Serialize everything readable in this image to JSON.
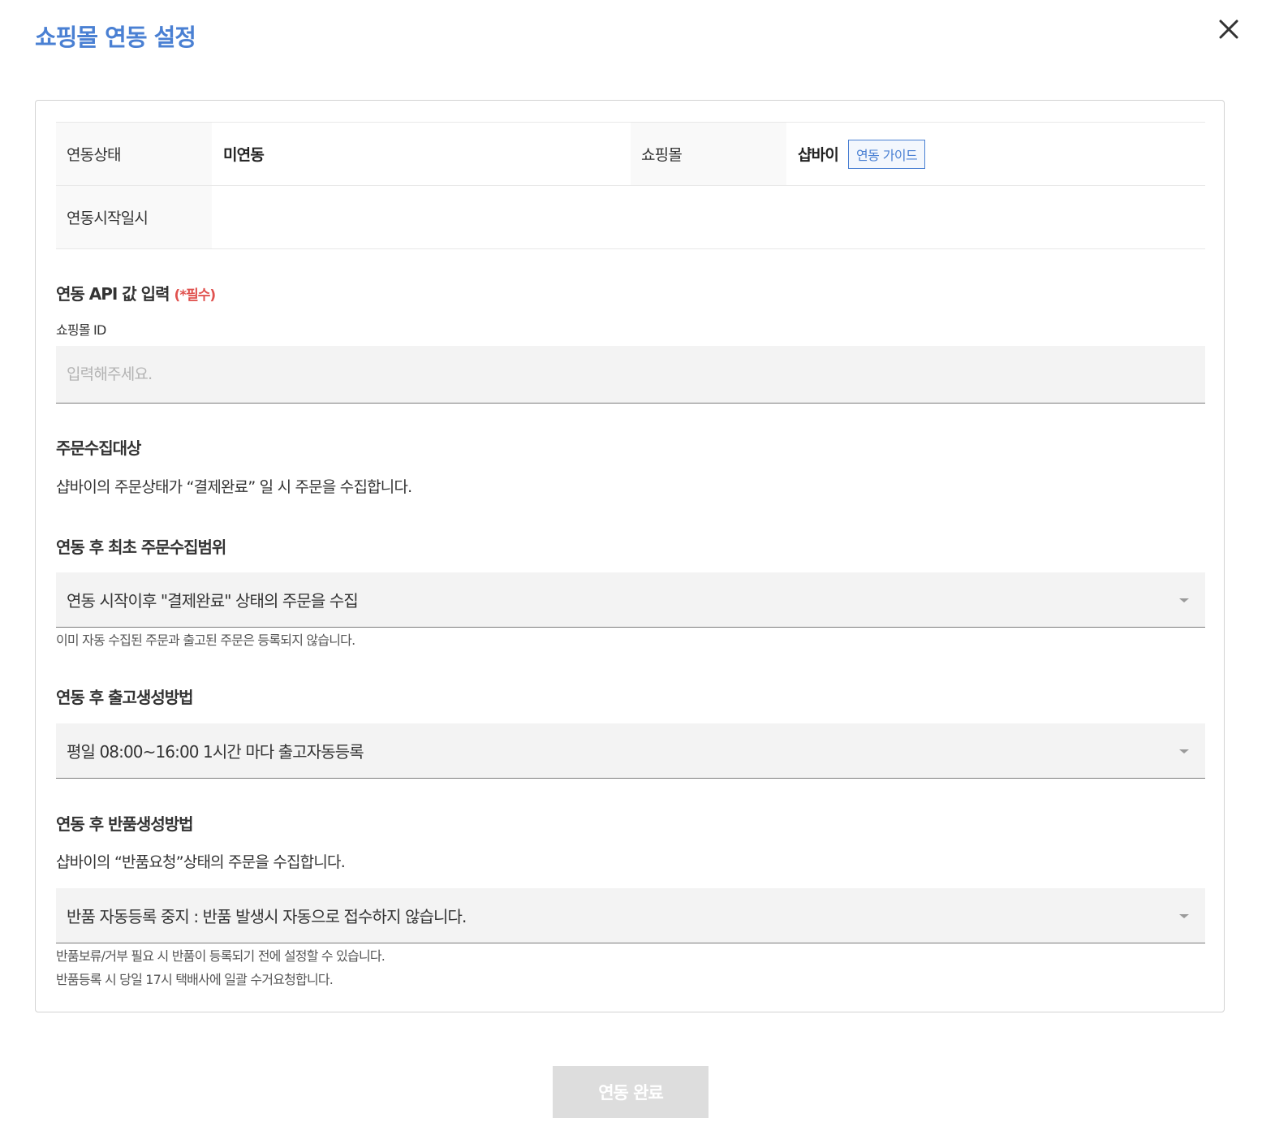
{
  "modal": {
    "title": "쇼핑몰 연동 설정"
  },
  "info": {
    "status_label": "연동상태",
    "status_value": "미연동",
    "mall_label": "쇼핑몰",
    "mall_value": "샵바이",
    "guide_button": "연동 가이드",
    "start_label": "연동시작일시",
    "start_value": ""
  },
  "api": {
    "heading": "연동 API 값 입력",
    "required": "(*필수)",
    "mall_id_label": "쇼핑몰 ID",
    "mall_id_placeholder": "입력해주세요.",
    "mall_id_value": ""
  },
  "order_target": {
    "heading": "주문수집대상",
    "description": "샵바이의 주문상태가 “결제완료” 일 시 주문을 수집합니다."
  },
  "initial_range": {
    "heading": "연동 후 최초 주문수집범위",
    "selected": "연동 시작이후 \"결제완료\" 상태의 주문을 수집",
    "note": "이미 자동 수집된 주문과 출고된 주문은 등록되지 않습니다."
  },
  "shipment": {
    "heading": "연동 후 출고생성방법",
    "selected": "평일 08:00~16:00 1시간 마다 출고자동등록"
  },
  "returns": {
    "heading": "연동 후 반품생성방법",
    "description": "샵바이의 “반품요청”상태의 주문을 수집합니다.",
    "selected": "반품 자동등록 중지 : 반품 발생시 자동으로 접수하지 않습니다.",
    "note_1": "반품보류/거부 필요 시 반품이 등록되기 전에 설정할 수 있습니다.",
    "note_2": "반품등록 시 당일 17시 택배사에 일괄 수거요청합니다."
  },
  "footer": {
    "submit_label": "연동 완료"
  },
  "colors": {
    "accent": "#4a80d3",
    "required": "#e0524f",
    "disabled_button": "#dddddd"
  },
  "icons": {
    "close": "close-icon",
    "dropdown": "chevron-down-icon"
  }
}
